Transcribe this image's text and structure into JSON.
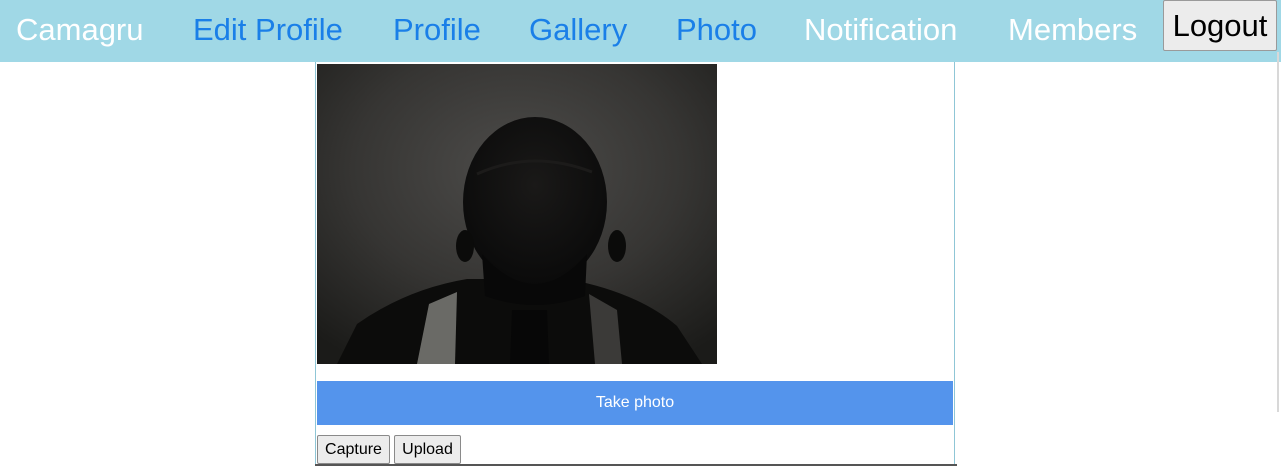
{
  "nav": {
    "brand": "Camagru",
    "items": [
      {
        "label": "Edit Profile"
      },
      {
        "label": "Profile"
      },
      {
        "label": "Gallery"
      },
      {
        "label": "Photo"
      },
      {
        "label": "Notification"
      },
      {
        "label": "Members"
      }
    ],
    "logout_label": "Logout"
  },
  "camera": {
    "take_photo_label": "Take photo",
    "capture_label": "Capture",
    "upload_label": "Upload"
  },
  "colors": {
    "navbar_bg": "#a0d8e6",
    "nav_link_blue": "#1a7fe8",
    "take_photo_bg": "#5494ec"
  }
}
